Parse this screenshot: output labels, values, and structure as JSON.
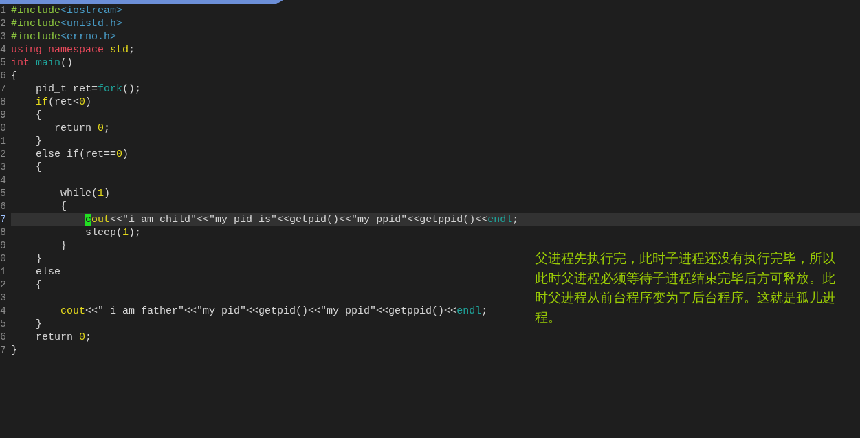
{
  "lines": [
    {
      "number": "1",
      "current": false,
      "tokens": [
        {
          "text": "#include",
          "kind": "pre"
        },
        {
          "text": "<iostream>",
          "kind": "header"
        }
      ]
    },
    {
      "number": "2",
      "current": false,
      "tokens": [
        {
          "text": "#include",
          "kind": "pre"
        },
        {
          "text": "<unistd.h>",
          "kind": "header"
        }
      ]
    },
    {
      "number": "3",
      "current": false,
      "tokens": [
        {
          "text": "#include",
          "kind": "pre"
        },
        {
          "text": "<errno.h>",
          "kind": "header"
        }
      ]
    },
    {
      "number": "4",
      "current": false,
      "tokens": [
        {
          "text": "using namespace ",
          "kind": "keyword"
        },
        {
          "text": "std",
          "kind": "number"
        },
        {
          "text": ";",
          "kind": "plain"
        }
      ]
    },
    {
      "number": "5",
      "current": false,
      "tokens": [
        {
          "text": "int ",
          "kind": "keyword"
        },
        {
          "text": "main",
          "kind": "function"
        },
        {
          "text": "()",
          "kind": "plain"
        }
      ]
    },
    {
      "number": "6",
      "current": false,
      "tokens": [
        {
          "text": "{",
          "kind": "plain"
        }
      ]
    },
    {
      "number": "7",
      "current": false,
      "tokens": [
        {
          "text": "    pid_t ret=",
          "kind": "plain"
        },
        {
          "text": "fork",
          "kind": "function"
        },
        {
          "text": "();",
          "kind": "plain"
        }
      ]
    },
    {
      "number": "8",
      "current": false,
      "tokens": [
        {
          "text": "    if",
          "kind": "number"
        },
        {
          "text": "(ret<",
          "kind": "plain"
        },
        {
          "text": "0",
          "kind": "number"
        },
        {
          "text": ")",
          "kind": "plain"
        }
      ]
    },
    {
      "number": "9",
      "current": false,
      "tokens": [
        {
          "text": "    {",
          "kind": "plain"
        }
      ]
    },
    {
      "number": "0",
      "current": false,
      "tokens": [
        {
          "text": "       return ",
          "kind": "plain"
        },
        {
          "text": "0",
          "kind": "number"
        },
        {
          "text": ";",
          "kind": "plain"
        }
      ]
    },
    {
      "number": "1",
      "current": false,
      "tokens": [
        {
          "text": "    }",
          "kind": "plain"
        }
      ]
    },
    {
      "number": "2",
      "current": false,
      "tokens": [
        {
          "text": "    else if(ret==",
          "kind": "plain"
        },
        {
          "text": "0",
          "kind": "number"
        },
        {
          "text": ")",
          "kind": "plain"
        }
      ]
    },
    {
      "number": "3",
      "current": false,
      "tokens": [
        {
          "text": "    {",
          "kind": "plain"
        }
      ]
    },
    {
      "number": "4",
      "current": false
    },
    {
      "number": "5",
      "current": false,
      "tokens": [
        {
          "text": "        while(",
          "kind": "plain"
        },
        {
          "text": "1",
          "kind": "number"
        },
        {
          "text": ")",
          "kind": "plain"
        }
      ]
    },
    {
      "number": "6",
      "current": false,
      "tokens": [
        {
          "text": "        {",
          "kind": "plain"
        }
      ]
    },
    {
      "number": "7",
      "current": true,
      "tokens": [
        {
          "text": "            c",
          "kind": "cursor"
        },
        {
          "text": "out",
          "kind": "number"
        },
        {
          "text": "<<\"i am child\"<<\"my pid is\"<<getpid()<<\"my ppid\"<<getppid()<<",
          "kind": "plain"
        },
        {
          "text": "endl",
          "kind": "function"
        },
        {
          "text": ";",
          "kind": "plain"
        }
      ]
    },
    {
      "number": "8",
      "current": false,
      "tokens": [
        {
          "text": "            sleep(",
          "kind": "plain"
        },
        {
          "text": "1",
          "kind": "number"
        },
        {
          "text": ");",
          "kind": "plain"
        }
      ]
    },
    {
      "number": "9",
      "current": false,
      "tokens": [
        {
          "text": "        }",
          "kind": "plain"
        }
      ]
    },
    {
      "number": "0",
      "current": false,
      "tokens": [
        {
          "text": "    }",
          "kind": "plain"
        }
      ]
    },
    {
      "number": "1",
      "current": false,
      "tokens": [
        {
          "text": "    else",
          "kind": "plain"
        }
      ]
    },
    {
      "number": "2",
      "current": false,
      "tokens": [
        {
          "text": "    {",
          "kind": "plain"
        }
      ]
    },
    {
      "number": "3",
      "current": false
    },
    {
      "number": "4",
      "current": false,
      "tokens": [
        {
          "text": "        cout",
          "kind": "number"
        },
        {
          "text": "<<\" i am father\"<<\"my pid\"<<getpid()<<\"my ppid\"<<getppid()<<",
          "kind": "plain"
        },
        {
          "text": "endl",
          "kind": "function"
        },
        {
          "text": ";",
          "kind": "plain"
        }
      ]
    },
    {
      "number": "5",
      "current": false,
      "tokens": [
        {
          "text": "    }",
          "kind": "plain"
        }
      ]
    },
    {
      "number": "6",
      "current": false,
      "tokens": [
        {
          "text": "    return ",
          "kind": "plain"
        },
        {
          "text": "0",
          "kind": "number"
        },
        {
          "text": ";",
          "kind": "plain"
        }
      ]
    },
    {
      "number": "7",
      "current": false,
      "tokens": [
        {
          "text": "}",
          "kind": "plain"
        }
      ]
    }
  ],
  "note": "父进程先执行完，此时子进程还没有执行完毕，所以此时父进程必须等待子进程结束完毕后方可释放。此时父进程从前台程序变为了后台程序。这就是孤儿进程。"
}
